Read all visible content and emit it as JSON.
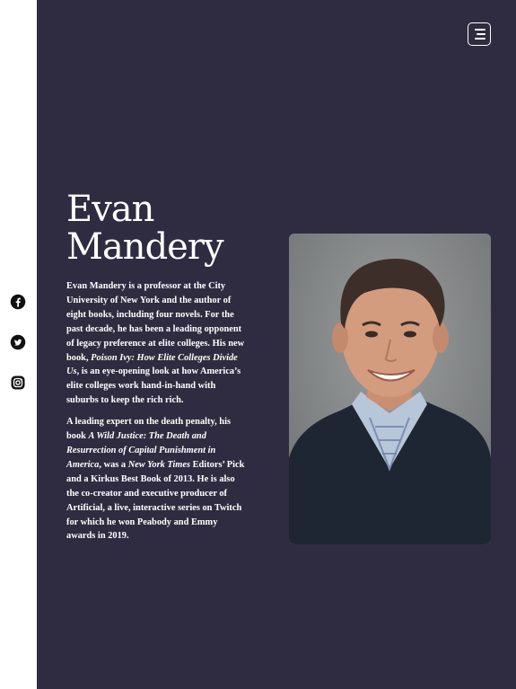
{
  "social": {
    "items": [
      {
        "name": "facebook",
        "icon": "facebook-icon"
      },
      {
        "name": "twitter",
        "icon": "twitter-icon"
      },
      {
        "name": "instagram",
        "icon": "instagram-icon"
      }
    ]
  },
  "header": {
    "menu_icon": "menu-icon"
  },
  "hero": {
    "title_line1": "Evan",
    "title_line2": "Mandery",
    "bio_p1": {
      "t1": "Evan Mandery is a professor at the City University of New York and the author of eight books, including four novels. For the past decade, he has been a leading opponent of legacy preference at elite colleges. His new book, ",
      "book1": "Poison Ivy: How Elite Colleges Divide Us",
      "t2": ", is an eye-opening look at how America’s elite colleges work hand-in-hand with suburbs to keep the rich rich."
    },
    "bio_p2": {
      "t1": "A leading expert on the death penalty, his book ",
      "book2": "A Wild Justice: The Death and Resurrection of Capital Punishment in America",
      "t2": ", was a ",
      "pub": "New York Times",
      "t3": " Editors’ Pick and a Kirkus Best Book of 2013. He is also the co-creator and executive producer of Artificial, a live, interactive series on Twitch for which he won Peabody and Emmy awards in 2019."
    }
  },
  "colors": {
    "panel_bg": "#2f2c41",
    "rail_bg": "#ffffff",
    "text": "#ffffff"
  }
}
